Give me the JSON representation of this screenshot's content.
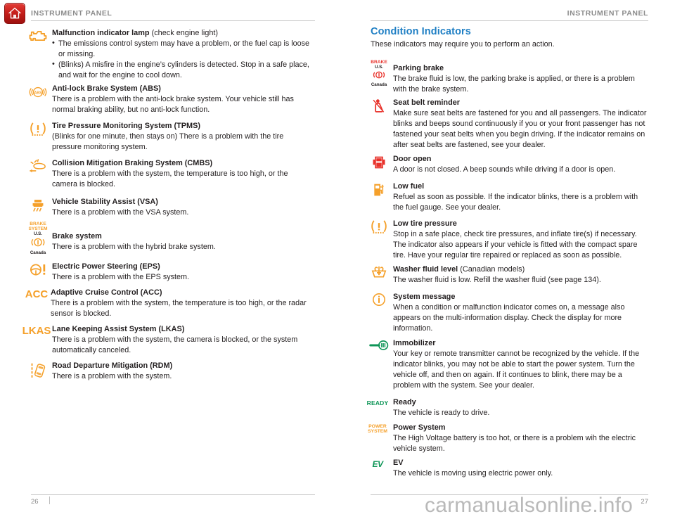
{
  "home_button": {
    "icon": "home-icon",
    "color": "#c8201c"
  },
  "running_head": {
    "left": "INSTRUMENT PANEL",
    "right": "INSTRUMENT PANEL"
  },
  "section": {
    "title": "Condition Indicators",
    "title_color": "#1f7fc4",
    "subtitle": "These indicators may require you to perform an action."
  },
  "colors": {
    "warning_orange": "#f5a02a",
    "alert_red": "#e8322b",
    "green": "#0e9557",
    "accent_blue": "#1f7fc4"
  },
  "left_column": {
    "entries": [
      {
        "icon": "check-engine-icon",
        "title": "Malfunction indicator lamp",
        "title_suffix": "(check engine light)",
        "bullets": [
          "The emissions control system may have a problem, or the fuel cap is loose or missing.",
          "(Blinks) A misfire in the engine’s cylinders is detected. Stop in a safe place, and wait for the engine to cool down."
        ]
      },
      {
        "icon": "abs-icon",
        "title": "Anti-lock Brake System (ABS)",
        "desc": "There is a problem with the anti-lock brake system. Your vehicle still has normal braking ability, but no anti-lock function."
      },
      {
        "icon": "tpms-icon",
        "title": "Tire Pressure Monitoring System (TPMS)",
        "desc": "(Blinks for one minute, then stays on) There is a problem with the tire pressure monitoring system."
      },
      {
        "icon": "cmbs-icon",
        "title": "Collision Mitigation Braking System (CMBS)",
        "desc": "There is a problem with the system, the temperature is too high, or the camera is blocked."
      },
      {
        "icon": "vsa-icon",
        "title": "Vehicle Stability Assist (VSA)",
        "desc": "There is a problem with the VSA system."
      },
      {
        "icon": "brake-system-icon",
        "icon_text": {
          "word1": "BRAKE",
          "word2": "SYSTEM",
          "label_us": "U.S.",
          "label_canada": "Canada"
        },
        "title": "Brake system",
        "desc": "There is a problem with the hybrid brake system."
      },
      {
        "icon": "eps-icon",
        "title": "Electric Power Steering (EPS)",
        "desc": "There is a problem with the EPS system."
      },
      {
        "icon": "acc-icon",
        "icon_text": "ACC",
        "title": "Adaptive Cruise Control (ACC)",
        "desc": "There is a problem with the system, the temperature is too high, or the radar sensor is blocked."
      },
      {
        "icon": "lkas-icon",
        "icon_text": "LKAS",
        "title": "Lane Keeping Assist System (LKAS)",
        "desc": "There is a problem with the system, the camera is blocked, or the system automatically canceled."
      },
      {
        "icon": "rdm-icon",
        "title": "Road Departure Mitigation (RDM)",
        "desc": "There is a problem with the system."
      }
    ]
  },
  "right_column": {
    "entries": [
      {
        "icon": "parking-brake-icon",
        "icon_text": {
          "word1": "BRAKE",
          "label_us": "U.S.",
          "label_canada": "Canada"
        },
        "title": "Parking brake",
        "desc": "The brake fluid is low, the parking brake is applied, or there is a problem with the brake system."
      },
      {
        "icon": "seat-belt-reminder-icon",
        "title": "Seat belt reminder",
        "desc": "Make sure seat belts are fastened for you and all passengers. The indicator blinks and beeps sound continuously if you or your front passenger has not fastened your seat belts when you begin driving. If the indicator remains on after seat belts are fastened, see your dealer."
      },
      {
        "icon": "door-open-icon",
        "title": "Door open",
        "desc": "A door is not closed. A beep sounds while driving if a door is open."
      },
      {
        "icon": "low-fuel-icon",
        "title": "Low fuel",
        "desc": "Refuel as soon as possible. If the indicator blinks, there is a problem with the fuel gauge. See your dealer."
      },
      {
        "icon": "low-tire-pressure-icon",
        "title": "Low tire pressure",
        "desc": "Stop in a safe place, check tire pressures, and inflate tire(s) if necessary. The indicator also appears if your vehicle is fitted with the compact spare tire. Have your regular tire repaired or replaced as soon as possible."
      },
      {
        "icon": "washer-fluid-icon",
        "title": "Washer fluid level",
        "title_suffix": "(Canadian models)",
        "desc": "The washer fluid is low. Refill the washer fluid (see page 134)."
      },
      {
        "icon": "system-message-icon",
        "title": "System message",
        "desc": "When a condition or malfunction indicator comes on, a message also appears on the multi-information display. Check the display for more information."
      },
      {
        "icon": "immobilizer-icon",
        "title": "Immobilizer",
        "desc": "Your key or remote transmitter cannot be recognized by the vehicle. If the indicator blinks, you may not be able to start the power system. Turn the vehicle off, and then on again. If it continues to blink, there may be a problem with the system. See your dealer."
      },
      {
        "icon": "ready-icon",
        "icon_text": "READY",
        "title": "Ready",
        "desc": "The vehicle is ready to drive."
      },
      {
        "icon": "power-system-icon",
        "icon_text": {
          "word1": "POWER",
          "word2": "SYSTEM"
        },
        "title": "Power System",
        "desc": "The High Voltage battery is too hot, or there is a problem wih the electric vehicle system."
      },
      {
        "icon": "ev-icon",
        "icon_text": "EV",
        "title": "EV",
        "desc": "The vehicle is moving using electric power only."
      }
    ]
  },
  "footer": {
    "page_left": "26",
    "page_right": "27",
    "watermark": "carmanualsonline.info"
  }
}
